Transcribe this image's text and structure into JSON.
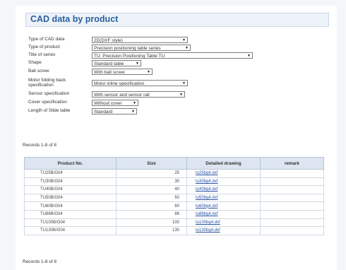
{
  "page": {
    "title": "CAD data by product",
    "records_top": "Records 1-8 of 8",
    "records_bottom": "Records 1-8 of 8"
  },
  "form": [
    {
      "label": "Type of CAD data",
      "value": "2D(DXF style)"
    },
    {
      "label": "Type of product",
      "value": "Precision positioning table series"
    },
    {
      "label": "Title of series",
      "value": "TU: Precision Positioning Table TU"
    },
    {
      "label": "Shape",
      "value": "Standard table"
    },
    {
      "label": "Ball screw",
      "value": "With ball screw"
    },
    {
      "label": "Motor folding back specification",
      "value": "Motor inline specification"
    },
    {
      "label": "Sensor specification",
      "value": "With sensor and sensor rail"
    },
    {
      "label": "Cover specification",
      "value": "Without cover"
    },
    {
      "label": "Length of Slide table",
      "value": "Standard"
    }
  ],
  "table": {
    "headers": [
      "Product No.",
      "Size",
      "Detailed drawing",
      "remark"
    ],
    "rows": [
      {
        "product": "TU25B/G04",
        "size": "25",
        "drawing": "tu25bg4.dxf",
        "remark": ""
      },
      {
        "product": "TU30B/G04",
        "size": "30",
        "drawing": "tu30bg4.dxf",
        "remark": ""
      },
      {
        "product": "TU40B/G04",
        "size": "40",
        "drawing": "tu40bg4.dxf",
        "remark": ""
      },
      {
        "product": "TU50B/G04",
        "size": "50",
        "drawing": "tu50bg4.dxf",
        "remark": ""
      },
      {
        "product": "TU60B/G04",
        "size": "60",
        "drawing": "tu60bg4.dxf",
        "remark": ""
      },
      {
        "product": "TU86B/G04",
        "size": "86",
        "drawing": "tu86bg4.dxf",
        "remark": ""
      },
      {
        "product": "TU100B/G04",
        "size": "100",
        "drawing": "tu100bg4.dxf",
        "remark": ""
      },
      {
        "product": "TU130B/G04",
        "size": "130",
        "drawing": "tu130bg4.dxf",
        "remark": ""
      }
    ]
  },
  "icons": {
    "dropdown": "chevron-down-icon"
  },
  "colors": {
    "title": "#2a5f9e",
    "header_bg": "#dce5f0",
    "link": "#2952a3"
  }
}
